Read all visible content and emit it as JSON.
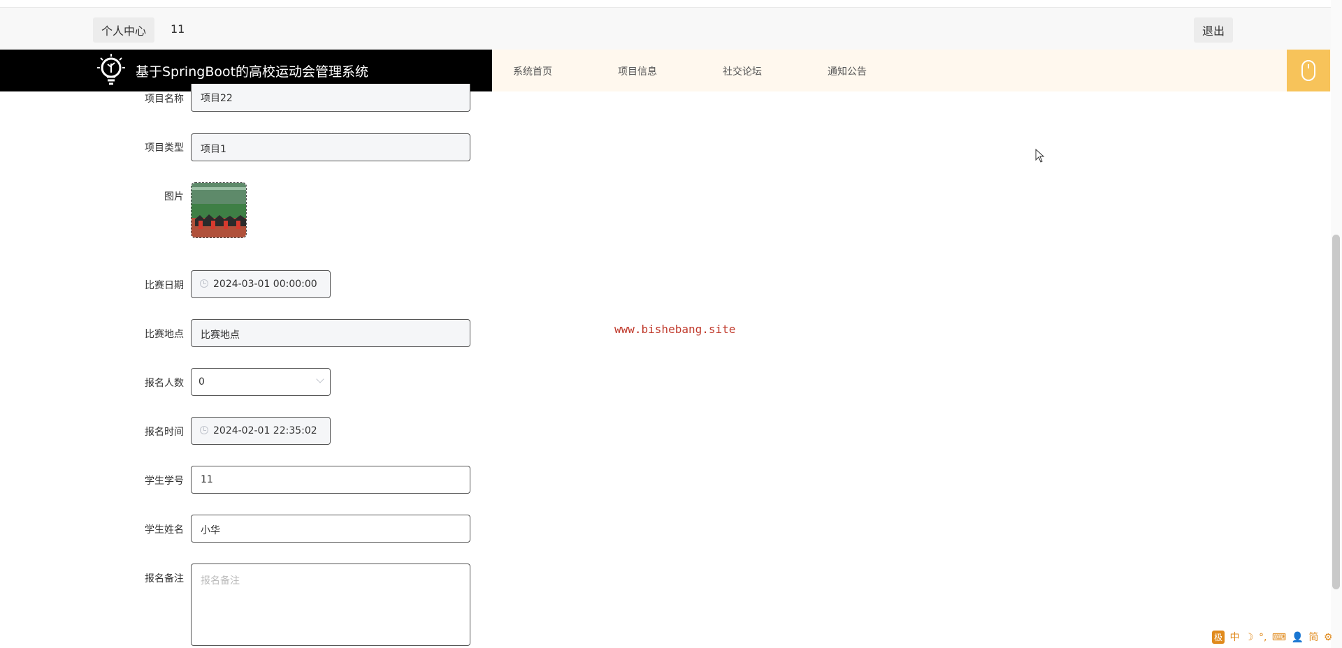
{
  "topbar": {
    "profile_label": "个人中心",
    "username": "11",
    "logout_label": "退出"
  },
  "navbar": {
    "title": "基于SpringBoot的高校运动会管理系统",
    "items": [
      "系统首页",
      "项目信息",
      "社交论坛",
      "通知公告"
    ]
  },
  "form": {
    "project_name": {
      "label": "项目名称",
      "value": "项目22"
    },
    "project_type": {
      "label": "项目类型",
      "value": "项目1"
    },
    "image": {
      "label": "图片"
    },
    "match_date": {
      "label": "比赛日期",
      "value": "2024-03-01 00:00:00"
    },
    "match_location": {
      "label": "比赛地点",
      "value": "比赛地点"
    },
    "signup_count": {
      "label": "报名人数",
      "value": "0"
    },
    "signup_time": {
      "label": "报名时间",
      "value": "2024-02-01 22:35:02"
    },
    "student_id": {
      "label": "学生学号",
      "value": "11"
    },
    "student_name": {
      "label": "学生姓名",
      "value": "小华"
    },
    "signup_note": {
      "label": "报名备注",
      "value": "",
      "placeholder": "报名备注"
    }
  },
  "watermark": "www.bishebang.site",
  "ime_toolbar": {
    "logo": "极",
    "items": [
      "中",
      "简"
    ]
  },
  "colors": {
    "brand_bg": "#000000",
    "navbar_bg": "#fff8ee",
    "accent": "#f7c35a",
    "watermark": "#c0392b"
  }
}
